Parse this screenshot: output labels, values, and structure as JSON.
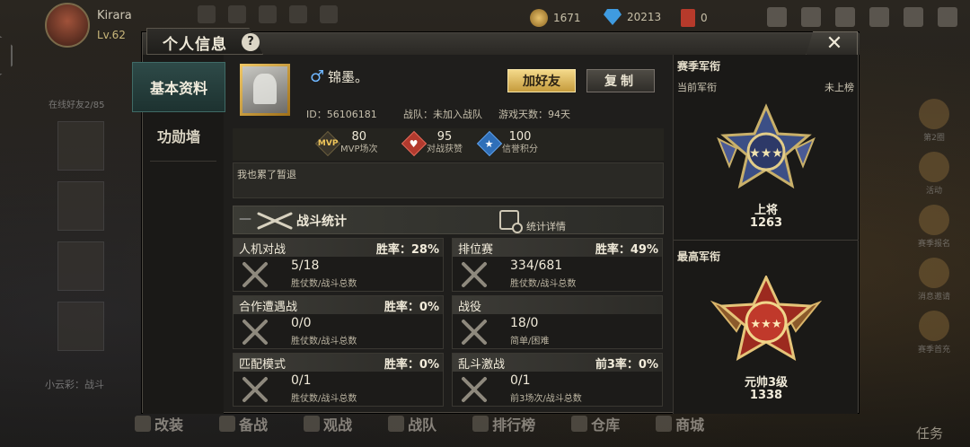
{
  "topbar": {
    "user_name": "Kirara",
    "user_level": "Lv.62",
    "gold": "1671",
    "diamonds": "20213",
    "cards": "0"
  },
  "left_list": {
    "online_label": "在线好友2/85",
    "chat_text": "小云彩：战斗"
  },
  "side_icons": [
    "第2圈",
    "活动",
    "赛季报名",
    "消息邀请",
    "赛季首充"
  ],
  "bottom_nav": [
    "改装",
    "备战",
    "观战",
    "战队",
    "排行榜",
    "仓库",
    "商城"
  ],
  "task_label": "任务",
  "modal": {
    "title": "个人信息",
    "help_symbol": "?",
    "close_symbol": "✕",
    "tabs": [
      {
        "label": "基本资料",
        "active": true
      },
      {
        "label": "功勋墙",
        "active": false
      }
    ]
  },
  "profile": {
    "gender_symbol": "♂",
    "nickname": "锦墨。",
    "add_friend_label": "加好友",
    "copy_label": "复制",
    "id_text": "ID：56106181",
    "team_text": "战队：未加入战队",
    "days_text": "游戏天数：94天",
    "stats": [
      {
        "icon": "mvp-icon",
        "value": "80",
        "label": "MVP场次"
      },
      {
        "icon": "heart-icon",
        "value": "95",
        "label": "对战获赞"
      },
      {
        "icon": "star-icon",
        "value": "100",
        "label": "信誉积分"
      }
    ],
    "signature": "我也累了暂退"
  },
  "battle": {
    "dash": "—",
    "title": "战斗统计",
    "detail_label": "统计详情",
    "cards": [
      {
        "title": "人机对战",
        "rate": "胜率：28%",
        "value": "5/18",
        "label": "胜仗数/战斗总数"
      },
      {
        "title": "排位赛",
        "rate": "胜率：49%",
        "value": "334/681",
        "label": "胜仗数/战斗总数"
      },
      {
        "title": "合作遭遇战",
        "rate": "胜率：0%",
        "value": "0/0",
        "label": "胜仗数/战斗总数"
      },
      {
        "title": "战役",
        "rate": "",
        "value": "18/0",
        "label": "简单/困难"
      },
      {
        "title": "匹配模式",
        "rate": "胜率：0%",
        "value": "0/1",
        "label": "胜仗数/战斗总数"
      },
      {
        "title": "乱斗激战",
        "rate": "前3率：0%",
        "value": "0/1",
        "label": "前3场次/战斗总数"
      }
    ]
  },
  "rank": {
    "season_title": "赛季军衔",
    "current_label": "当前军衔",
    "current_status": "未上榜",
    "current_rank_name": "上将",
    "current_rank_score": "1263",
    "highest_title": "最高军衔",
    "highest_rank_name": "元帅3级",
    "highest_rank_score": "1338"
  },
  "colors": {
    "accent_gold": "#f4d98a",
    "active_tab": "#2e4a48",
    "gender_blue": "#6fb7ff"
  }
}
